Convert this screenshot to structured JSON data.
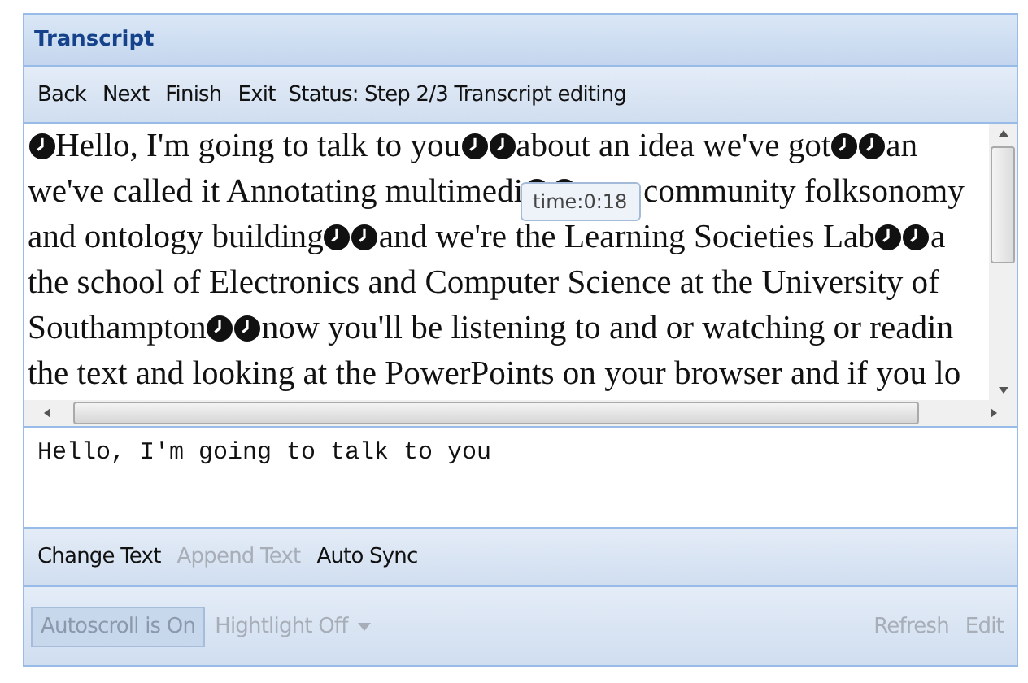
{
  "panel": {
    "title": "Transcript"
  },
  "toolbar": {
    "buttons": [
      {
        "label": "Back"
      },
      {
        "label": "Next"
      },
      {
        "label": "Finish"
      },
      {
        "label": "Exit"
      }
    ],
    "status": "Status: Step 2/3 Transcript editing"
  },
  "transcript": {
    "lines": [
      [
        {
          "kind": "marker"
        },
        {
          "kind": "text",
          "text": "Hello, I'm going to talk to you"
        },
        {
          "kind": "marker"
        },
        {
          "kind": "marker"
        },
        {
          "kind": "text",
          "text": "about an idea we've got"
        },
        {
          "kind": "marker"
        },
        {
          "kind": "marker"
        },
        {
          "kind": "text",
          "text": "an"
        }
      ],
      [
        {
          "kind": "text",
          "text": "we've called it Annotating multimedi"
        },
        {
          "kind": "marker"
        },
        {
          "kind": "marker"
        },
        {
          "kind": "gap"
        },
        {
          "kind": "text",
          "text": "community folksonomy"
        }
      ],
      [
        {
          "kind": "text",
          "text": "and ontology building"
        },
        {
          "kind": "marker"
        },
        {
          "kind": "marker"
        },
        {
          "kind": "text",
          "text": "and we're the Learning Societies Lab"
        },
        {
          "kind": "marker"
        },
        {
          "kind": "marker"
        },
        {
          "kind": "text",
          "text": "a"
        }
      ],
      [
        {
          "kind": "text",
          "text": "the school of Electronics and Computer Science at the University of"
        }
      ],
      [
        {
          "kind": "text",
          "text": "Southampton"
        },
        {
          "kind": "marker"
        },
        {
          "kind": "marker"
        },
        {
          "kind": "text",
          "text": "now you'll be listening to and or watching or readin"
        }
      ],
      [
        {
          "kind": "text",
          "text": "the text and looking at the PowerPoints on your browser and if you lo"
        }
      ]
    ],
    "tooltip": "time:0:18"
  },
  "editor": {
    "value": "Hello, I'm going to talk to you"
  },
  "edit_buttons": [
    {
      "label": "Change Text",
      "disabled": false
    },
    {
      "label": "Append Text",
      "disabled": true
    },
    {
      "label": "Auto Sync",
      "disabled": false
    }
  ],
  "bottom_bar": {
    "autoscroll": {
      "label": "Autoscroll is On",
      "pressed": true,
      "disabled": true
    },
    "highlight": {
      "label": "Hightlight Off",
      "disabled": true
    },
    "right_buttons": [
      {
        "label": "Refresh",
        "disabled": true
      },
      {
        "label": "Edit",
        "disabled": true
      }
    ]
  }
}
